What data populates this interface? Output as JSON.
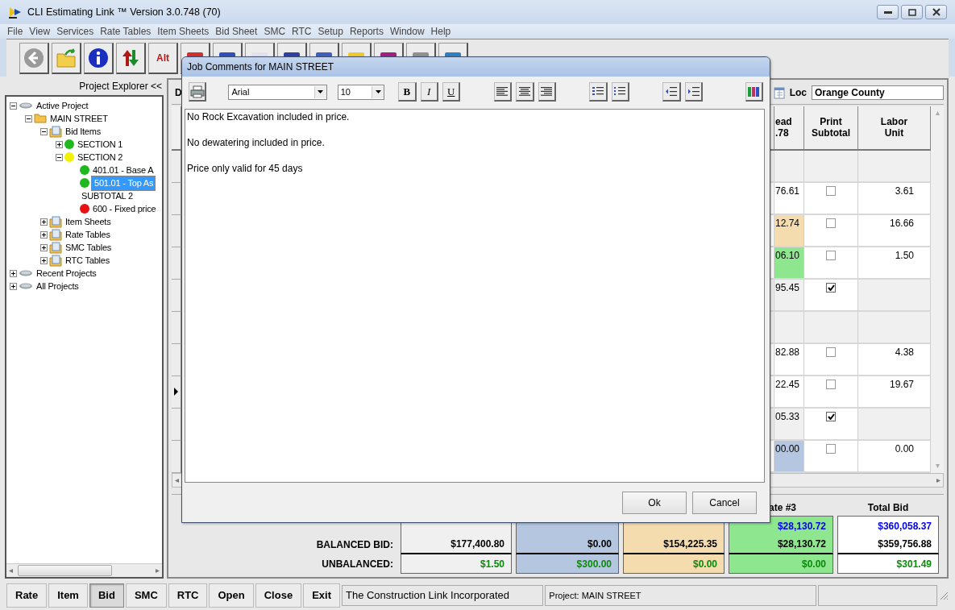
{
  "window": {
    "title": "CLI Estimating Link ™ Version  3.0.748 (70)"
  },
  "menu": [
    "File",
    "View",
    "Services",
    "Rate Tables",
    "Item Sheets",
    "Bid Sheet",
    "SMC",
    "RTC",
    "Setup",
    "Reports",
    "Window",
    "Help"
  ],
  "toolbar": {
    "alt_button": "Alt"
  },
  "project_explorer": {
    "title": "Project Explorer <<",
    "tree": [
      {
        "label": "Active Project",
        "kind": "drive",
        "expanded": true,
        "selected": false,
        "children": [
          {
            "label": "MAIN STREET",
            "kind": "folder",
            "expanded": true,
            "selected": false,
            "children": [
              {
                "label": "Bid Items",
                "kind": "sheet",
                "expanded": true,
                "selected": false,
                "children": [
                  {
                    "label": "SECTION 1",
                    "kind": "status",
                    "color": "#1fb81f",
                    "expanded": false,
                    "selected": false
                  },
                  {
                    "label": "SECTION 2",
                    "kind": "status",
                    "color": "#f2f200",
                    "expanded": true,
                    "selected": false,
                    "children": [
                      {
                        "label": "401.01 - Base A",
                        "kind": "status",
                        "color": "#1fb81f",
                        "selected": false
                      },
                      {
                        "label": "501.01 - Top As",
                        "kind": "status",
                        "color": "#1fb81f",
                        "selected": true
                      },
                      {
                        "label": "SUBTOTAL 2",
                        "kind": "plain",
                        "selected": false
                      },
                      {
                        "label": "600 - Fixed price",
                        "kind": "status",
                        "color": "#e81010",
                        "selected": false
                      }
                    ]
                  }
                ]
              },
              {
                "label": "Item Sheets",
                "kind": "sheet",
                "expanded": false,
                "selected": false
              },
              {
                "label": "Rate Tables",
                "kind": "sheet",
                "expanded": false,
                "selected": false
              },
              {
                "label": "SMC Tables",
                "kind": "sheet",
                "expanded": false,
                "selected": false
              },
              {
                "label": "RTC Tables",
                "kind": "sheet",
                "expanded": false,
                "selected": false
              }
            ]
          }
        ]
      },
      {
        "label": "Recent Projects",
        "kind": "drive",
        "expanded": false,
        "selected": false
      },
      {
        "label": "All Projects",
        "kind": "drive",
        "expanded": false,
        "selected": false
      }
    ]
  },
  "grid": {
    "cut_header": "D",
    "loc_label": "Loc",
    "loc_value": "Orange County",
    "columns": [
      "ead\n.78",
      "Print\nSubtotal",
      "Labor\nUnit"
    ],
    "rows": [
      {
        "kind": "section",
        "current": false
      },
      {
        "kind": "item",
        "current": false,
        "column_1": "76.61",
        "checked": false,
        "labor_unit": "3.61"
      },
      {
        "kind": "item",
        "current": false,
        "column_1": "12.74",
        "color": "#f5dcae",
        "checked": false,
        "labor_unit": "16.66"
      },
      {
        "kind": "item",
        "current": false,
        "column_1": "06.10",
        "color": "#8ee68e",
        "checked": false,
        "labor_unit": "1.50"
      },
      {
        "kind": "subtotal",
        "current": false,
        "column_1": "95.45",
        "checked": true
      },
      {
        "kind": "section",
        "current": false
      },
      {
        "kind": "item",
        "current": false,
        "column_1": "82.88",
        "checked": false,
        "labor_unit": "4.38"
      },
      {
        "kind": "item",
        "current": true,
        "column_1": "22.45",
        "checked": false,
        "labor_unit": "19.67"
      },
      {
        "kind": "subtotal",
        "current": false,
        "column_1": "05.33",
        "checked": true
      },
      {
        "kind": "item",
        "current": false,
        "column_1": "00.00",
        "color": "#b4c6e0",
        "checked": false,
        "labor_unit": "0.00"
      }
    ]
  },
  "summary": {
    "rows": [
      {
        "kind": "total"
      },
      {
        "kind": "balanced",
        "label": "BALANCED BID:"
      },
      {
        "kind": "unbalanced",
        "label": "UNBALANCED:"
      }
    ],
    "columns": [
      {
        "color": "#f0f0f0",
        "balanced": "$177,400.80",
        "unbalanced": "$1.50"
      },
      {
        "color": "#b4c6e0",
        "balanced": "$0.00",
        "unbalanced": "$300.00"
      },
      {
        "color": "#f5dcae",
        "balanced": "$154,225.35",
        "unbalanced": "$0.00"
      },
      {
        "color": "#8ee68e",
        "header": "ate #3",
        "total": "$28,130.72",
        "balanced": "$28,130.72",
        "unbalanced": "$0.00"
      },
      {
        "color": "#ffffff",
        "header": "Total Bid",
        "total": "$360,058.37",
        "balanced": "$359,756.88",
        "unbalanced": "$301.49"
      }
    ]
  },
  "dialog": {
    "title": "Job Comments for MAIN STREET",
    "font": "Arial",
    "size": "10",
    "bold": "B",
    "italic": "I",
    "underline": "U",
    "lines": [
      "No Rock Excavation included in price.",
      "No dewatering included in price.",
      "Price only valid for 45 days"
    ],
    "buttons": [
      "Ok",
      "Cancel"
    ]
  },
  "bottom": {
    "buttons": [
      {
        "label": "Rate",
        "selected": false
      },
      {
        "label": "Item",
        "selected": false
      },
      {
        "label": "Bid",
        "selected": true
      },
      {
        "label": "SMC",
        "selected": false
      },
      {
        "label": "RTC",
        "selected": false
      },
      {
        "label": "Open",
        "selected": false
      },
      {
        "label": "Close",
        "selected": false
      },
      {
        "label": "Exit",
        "selected": false
      }
    ],
    "status": [
      "The Construction Link Incorporated",
      "Project: MAIN STREET"
    ]
  }
}
